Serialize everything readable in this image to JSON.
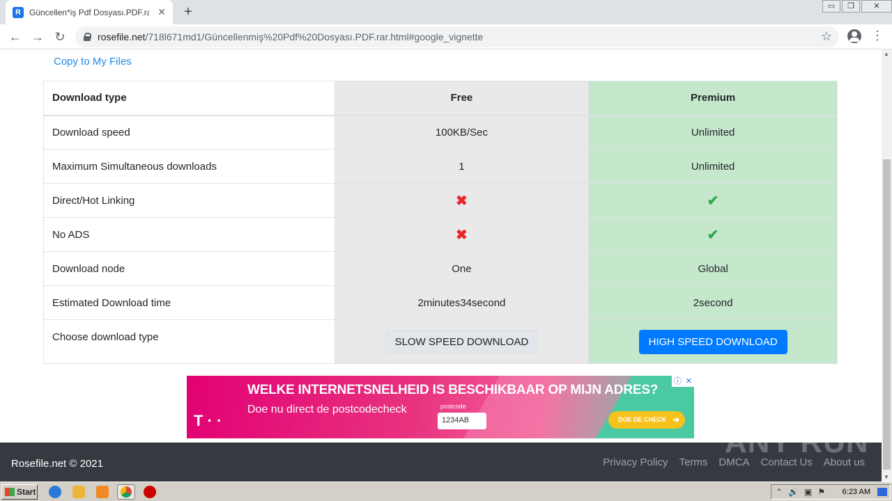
{
  "browser": {
    "tab_title": "Güncellen*iş Pdf Dosyası.PDF.rar - R",
    "tab_close": "✕",
    "new_tab": "+",
    "url_host": "rosefile.net",
    "url_path": "/718l671md1/Güncellenmiş%20Pdf%20Dosyası.PDF.rar.html#google_vignette",
    "back": "←",
    "forward": "→",
    "reload": "↻",
    "star": "☆",
    "menu": "⋮",
    "minimize": "▭",
    "restore": "❐",
    "close": "✕"
  },
  "page": {
    "copy_link": "Copy to My Files",
    "table": {
      "headers": [
        "Download type",
        "Free",
        "Premium"
      ],
      "rows": [
        {
          "label": "Download speed",
          "free": "100KB/Sec",
          "premium": "Unlimited"
        },
        {
          "label": "Maximum Simultaneous downloads",
          "free": "1",
          "premium": "Unlimited"
        },
        {
          "label": "Direct/Hot Linking",
          "free": "✖",
          "premium": "✔"
        },
        {
          "label": "No ADS",
          "free": "✖",
          "premium": "✔"
        },
        {
          "label": "Download node",
          "free": "One",
          "premium": "Global"
        },
        {
          "label": "Estimated Download time",
          "free": "2minutes34second",
          "premium": "2second"
        }
      ],
      "choose_label": "Choose download type",
      "slow_button": "SLOW SPEED DOWNLOAD",
      "fast_button": "HIGH SPEED DOWNLOAD"
    },
    "ad": {
      "headline": "WELKE INTERNETSNELHEID IS BESCHIKBAAR OP MIJN ADRES?",
      "sub": "Doe nu direct de postcodecheck",
      "logo": "T · ·",
      "input_label": "postcode",
      "input_value": "1234AB",
      "cta": "DOE DE CHECK",
      "cta_arrow": "➜",
      "choices_i": "ⓘ",
      "choices_x": "✕"
    },
    "footer": {
      "copyright": "Rosefile.net © 2021",
      "links": [
        "Privacy Policy",
        "Terms",
        "DMCA",
        "Contact Us",
        "About us"
      ]
    },
    "watermark": "ANY RUN"
  },
  "taskbar": {
    "start": "Start",
    "clock": "6:23 AM"
  }
}
